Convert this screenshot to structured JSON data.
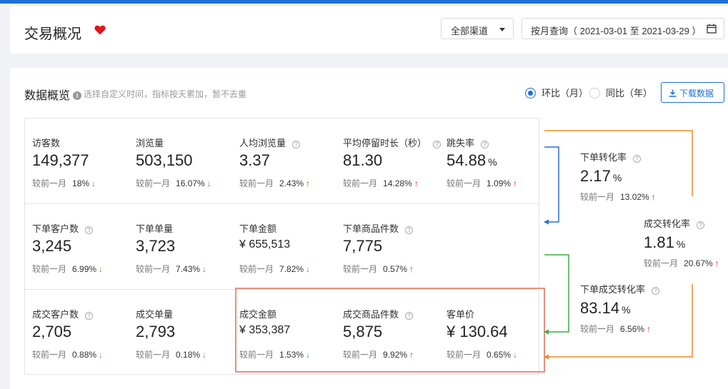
{
  "header": {
    "title": "交易概况"
  },
  "channel_select": {
    "value": "全部渠道"
  },
  "date_range": {
    "value": "按月查询（ 2021-03-01 至 2021-03-29 ）"
  },
  "overview": {
    "title": "数据概览",
    "hint": "选择自定义时间，指标按天累加，暂不去重",
    "radio_month": "环比（月）",
    "radio_year": "同比（年）",
    "download": "下载数据"
  },
  "compare_label": "较前一月",
  "rows": [
    [
      {
        "label": "访客数",
        "value": "149,377",
        "pct": "18%",
        "dir": "down",
        "q": false
      },
      {
        "label": "浏览量",
        "value": "503,150",
        "pct": "16.07%",
        "dir": "down",
        "q": false
      },
      {
        "label": "人均浏览量",
        "value": "3.37",
        "pct": "2.43%",
        "dir": "up",
        "q": true
      },
      {
        "label": "平均停留时长（秒）",
        "value": "81.30",
        "pct": "14.28%",
        "dir": "up",
        "q": true
      },
      {
        "label": "跳失率",
        "value": "54.88",
        "unit": "%",
        "pct": "1.09%",
        "dir": "up",
        "q": true
      }
    ],
    [
      {
        "label": "下单客户数",
        "value": "3,245",
        "pct": "6.99%",
        "dir": "down",
        "q": true
      },
      {
        "label": "下单单量",
        "value": "3,723",
        "pct": "7.43%",
        "dir": "down",
        "q": false
      },
      {
        "label": "下单金额",
        "value": "¥ 655,513",
        "pct": "7.82%",
        "dir": "down",
        "q": false,
        "small": true
      },
      {
        "label": "下单商品件数",
        "value": "7,775",
        "pct": "0.57%",
        "dir": "up",
        "q": true
      }
    ],
    [
      {
        "label": "成交客户数",
        "value": "2,705",
        "pct": "0.88%",
        "dir": "down",
        "q": true
      },
      {
        "label": "成交单量",
        "value": "2,793",
        "pct": "0.18%",
        "dir": "down",
        "q": false
      },
      {
        "label": "成交金额",
        "value": "¥ 353,387",
        "pct": "1.53%",
        "dir": "down",
        "q": false,
        "small": true
      },
      {
        "label": "成交商品件数",
        "value": "5,875",
        "pct": "9.92%",
        "dir": "up",
        "q": true
      },
      {
        "label": "客单价",
        "value": "¥ 130.64",
        "pct": "0.65%",
        "dir": "down",
        "q": false
      }
    ]
  ],
  "funnel": [
    {
      "label": "下单转化率",
      "value": "2.17",
      "unit": "%",
      "pct": "13.02%",
      "dir": "up"
    },
    {
      "label": "成交转化率",
      "value": "1.81",
      "unit": "%",
      "pct": "20.67%",
      "dir": "up"
    },
    {
      "label": "下单成交转化率",
      "value": "83.14",
      "unit": "%",
      "pct": "6.56%",
      "dir": "up"
    }
  ],
  "colors": {
    "primary": "#1f6fd6",
    "up": "#e02020",
    "down": "#3cae3c",
    "orange": "#f08a24",
    "green": "#3cae3c",
    "highlight": "#e59181"
  }
}
